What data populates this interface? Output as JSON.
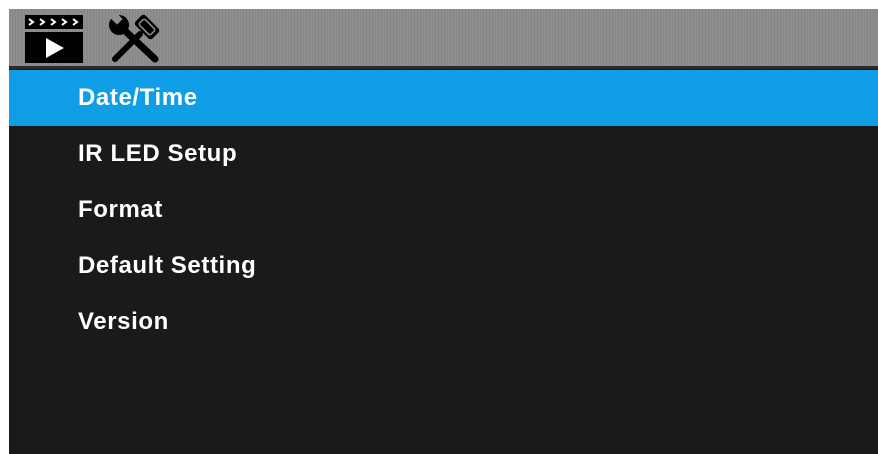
{
  "header": {
    "tabs": [
      {
        "icon": "video-playback-icon",
        "selected": false
      },
      {
        "icon": "wrench-screwdriver-icon",
        "selected": true
      }
    ]
  },
  "colors": {
    "screen_background": "#1a1a1a",
    "header_background": "#8e8e8e",
    "selection_highlight": "#0f9ee6",
    "text": "#ffffff"
  },
  "menu": {
    "selected_index": 0,
    "items": [
      {
        "label": "Date/Time"
      },
      {
        "label": "IR LED Setup"
      },
      {
        "label": "Format"
      },
      {
        "label": "Default Setting"
      },
      {
        "label": "Version"
      }
    ]
  }
}
